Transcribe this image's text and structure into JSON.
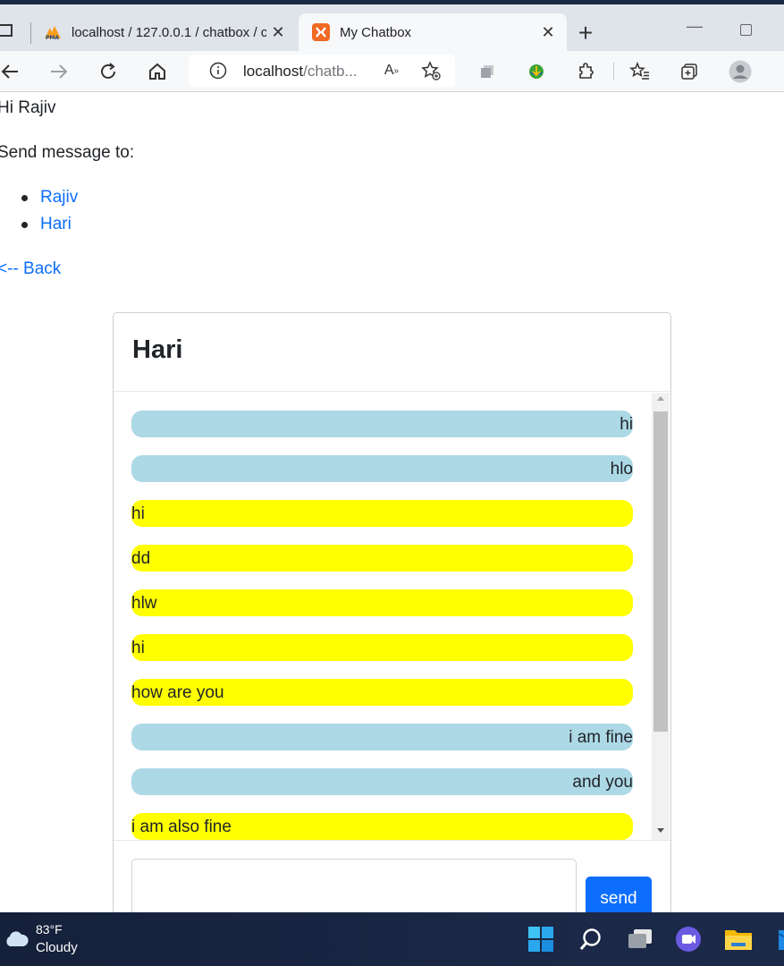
{
  "browser": {
    "tabs": [
      {
        "title": "localhost / 127.0.0.1 / chatbox / c",
        "icon": "phpmyadmin-icon",
        "active": false
      },
      {
        "title": "My Chatbox",
        "icon": "xampp-icon",
        "active": true
      }
    ],
    "address": {
      "host": "localhost",
      "path": "/chatb..."
    }
  },
  "page": {
    "greeting": "Hi Rajiv",
    "send_label": "Send message to:",
    "users": [
      "Rajiv",
      "Hari"
    ],
    "back_link": "<-- Back"
  },
  "chat": {
    "title": "Hari",
    "messages": [
      {
        "text": "hi",
        "kind": "sent"
      },
      {
        "text": "hlo",
        "kind": "sent"
      },
      {
        "text": "hi",
        "kind": "recv"
      },
      {
        "text": "dd",
        "kind": "recv"
      },
      {
        "text": "hlw",
        "kind": "recv"
      },
      {
        "text": "hi",
        "kind": "recv"
      },
      {
        "text": "how are you",
        "kind": "recv"
      },
      {
        "text": "i am fine",
        "kind": "sent"
      },
      {
        "text": "and you",
        "kind": "sent"
      },
      {
        "text": "i am also fine",
        "kind": "recv"
      }
    ],
    "send_button": "send",
    "colors": {
      "sent": "#add8e6",
      "recv": "#ffff00",
      "button": "#0d6efd",
      "link": "#0d6efd"
    }
  },
  "taskbar": {
    "weather_temp": "83°F",
    "weather_desc": "Cloudy"
  }
}
